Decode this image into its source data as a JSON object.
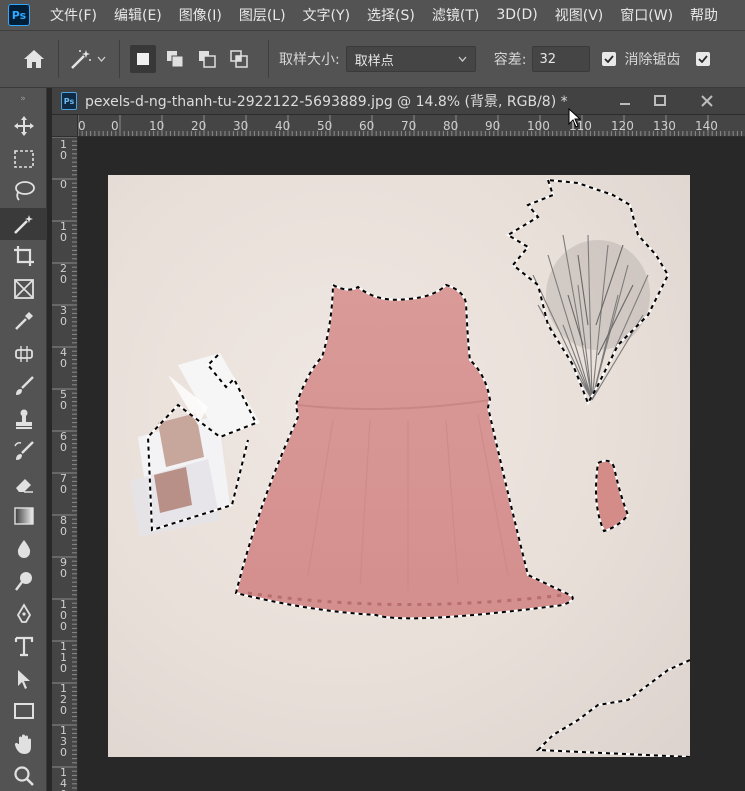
{
  "app": {
    "logo_text": "Ps",
    "brand_color": "#31a8ff"
  },
  "menubar": {
    "items": [
      "文件(F)",
      "编辑(E)",
      "图像(I)",
      "图层(L)",
      "文字(Y)",
      "选择(S)",
      "滤镜(T)",
      "3D(D)",
      "视图(V)",
      "窗口(W)",
      "帮助"
    ]
  },
  "options": {
    "sample_size_label": "取样大小:",
    "sample_size_value": "取样点",
    "tolerance_label": "容差:",
    "tolerance_value": "32",
    "antialias_label": "消除锯齿",
    "antialias_checked": true,
    "contiguous_checked": true
  },
  "toolbar": {
    "grip": "»",
    "tools": [
      "move-tool-icon",
      "marquee-tool-icon",
      "lasso-tool-icon",
      "magic-wand-tool-icon",
      "crop-tool-icon",
      "frame-tool-icon",
      "eyedropper-tool-icon",
      "healing-brush-icon",
      "brush-tool-icon",
      "clone-stamp-icon",
      "history-brush-icon",
      "eraser-tool-icon",
      "gradient-tool-icon",
      "blur-tool-icon",
      "dodge-tool-icon",
      "pen-tool-icon",
      "type-tool-icon",
      "path-selection-icon",
      "rectangle-tool-icon",
      "hand-tool-icon",
      "zoom-tool-icon"
    ],
    "active_tool": "magic-wand-tool-icon"
  },
  "document": {
    "icon_text": "Ps",
    "title": "pexels-d-ng-thanh-tu-2922122-5693889.jpg  @  14.8% (背景, RGB/8) *"
  },
  "ruler": {
    "top_labels": [
      "0",
      "0",
      "10",
      "20",
      "30",
      "40",
      "50",
      "60",
      "70",
      "80",
      "90",
      "100",
      "110",
      "120",
      "130",
      "140"
    ],
    "left_labels": [
      "10",
      "0",
      "10",
      "20",
      "30",
      "40",
      "50",
      "60",
      "70",
      "80",
      "90",
      "100",
      "110",
      "120",
      "130",
      "140"
    ]
  },
  "colors": {
    "panel_bg": "#535353",
    "canvas_bg": "#282828",
    "dress": "#d99a98",
    "selection": "#ffffff"
  }
}
